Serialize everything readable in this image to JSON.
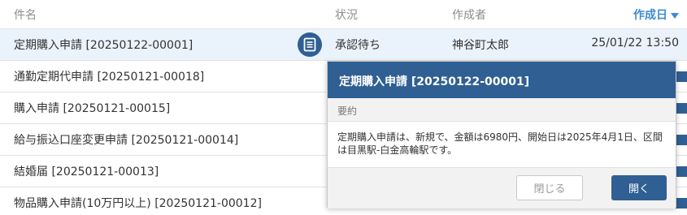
{
  "columns": {
    "name": "件名",
    "status": "状況",
    "author": "作成者",
    "created": "作成日"
  },
  "rows": [
    {
      "name": "定期購入申請 [20250122-00001]",
      "status": "承認待ち",
      "author": "神谷町太郎",
      "date": "25/01/22 13:50"
    },
    {
      "name": "通勤定期代申請 [20250121-00018]"
    },
    {
      "name": "購入申請 [20250121-00015]"
    },
    {
      "name": "給与振込口座変更申請 [20250121-00014]"
    },
    {
      "name": "結婚届 [20250121-00013]"
    },
    {
      "name": "物品購入申請(10万円以上) [20250121-00012]"
    }
  ],
  "popup": {
    "title": "定期購入申請 [20250122-00001]",
    "summary_label": "要約",
    "summary_text": "定期購入申請は、新規で、金額は6980円、開始日は2025年4月1日、区間は目黒駅-白金高輪駅です。",
    "close_label": "閉じる",
    "open_label": "開く"
  },
  "colors": {
    "accent": "#2f5f93",
    "link": "#3e8bd1",
    "selected_row": "#eaf2fb"
  }
}
